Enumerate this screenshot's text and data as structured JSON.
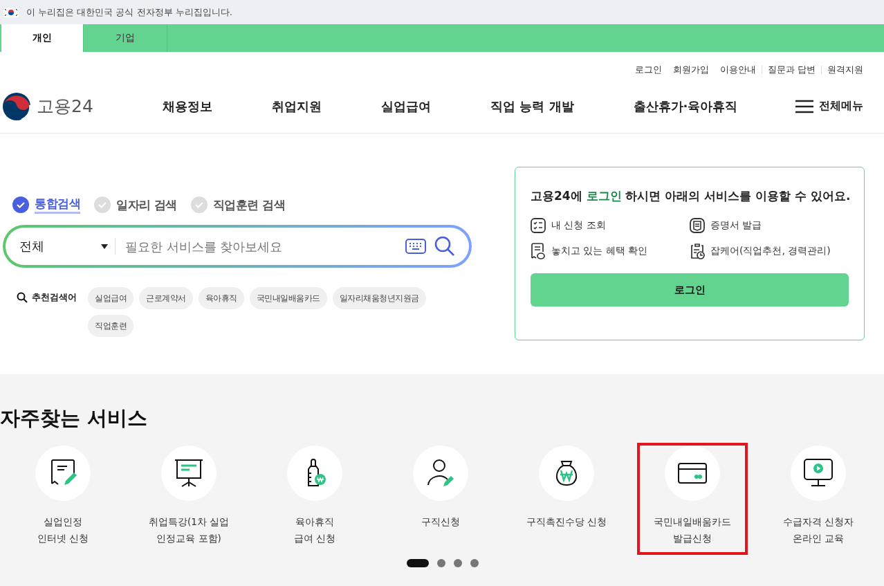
{
  "gov_banner": {
    "text": "이 누리집은 대한민국 공식 전자정부 누리집입니다."
  },
  "audience_tabs": [
    {
      "label": "개인",
      "selected": true
    },
    {
      "label": "기업",
      "selected": false
    }
  ],
  "utility_links": [
    "로그인",
    "회원가입",
    "이용안내",
    "질문과 답변",
    "원격지원"
  ],
  "logo": {
    "text": "고용24"
  },
  "nav": [
    "채용정보",
    "취업지원",
    "실업급여",
    "직업 능력 개발",
    "출산휴가·육아휴직"
  ],
  "all_menu": "전체메뉴",
  "search_types": [
    {
      "label": "통합검색",
      "selected": true
    },
    {
      "label": "일자리 검색",
      "selected": false
    },
    {
      "label": "직업훈련 검색",
      "selected": false
    }
  ],
  "search": {
    "category": "전체",
    "placeholder": "필요한 서비스를 찾아보세요"
  },
  "recommended": {
    "label": "추천검색어",
    "keywords": [
      "실업급여",
      "근로계약서",
      "육아휴직",
      "국민내일배움카드",
      "일자리채움청년지원금",
      "직업훈련"
    ]
  },
  "login_card": {
    "headline": "고용24에 **로그인** 하시면 아래의 서비스를 이용할 수 있어요.",
    "features": [
      {
        "kind": "checklist",
        "label": "내 신청 조회"
      },
      {
        "kind": "certificate",
        "label": "증명서 발급"
      },
      {
        "kind": "benefit",
        "label": "놓치고 있는 혜택 확인"
      },
      {
        "kind": "jobcare",
        "label": "잡케어(직업추천, 경력관리)"
      }
    ],
    "button": "로그인"
  },
  "services": {
    "title": "자주찾는 서비스",
    "items": [
      {
        "kind": "document",
        "lines": [
          "실업인정",
          "인터넷 신청"
        ],
        "highlighted": false
      },
      {
        "kind": "lecture",
        "lines": [
          "취업특강(1차 실업",
          "인정교육 포함)"
        ],
        "highlighted": false
      },
      {
        "kind": "bottle",
        "lines": [
          "육아휴직",
          "급여 신청"
        ],
        "highlighted": false
      },
      {
        "kind": "person",
        "lines": [
          "구직신청"
        ],
        "highlighted": false
      },
      {
        "kind": "moneybag",
        "lines": [
          "구직촉진수당 신청"
        ],
        "highlighted": false
      },
      {
        "kind": "card",
        "lines": [
          "국민내일배움카드",
          "발급신청"
        ],
        "highlighted": true
      },
      {
        "kind": "monitor",
        "lines": [
          "수급자격 신청자",
          "온라인 교육"
        ],
        "highlighted": false
      }
    ],
    "pages": [
      {
        "selected": true
      },
      {
        "selected": false
      },
      {
        "selected": false
      },
      {
        "selected": false
      }
    ]
  }
}
